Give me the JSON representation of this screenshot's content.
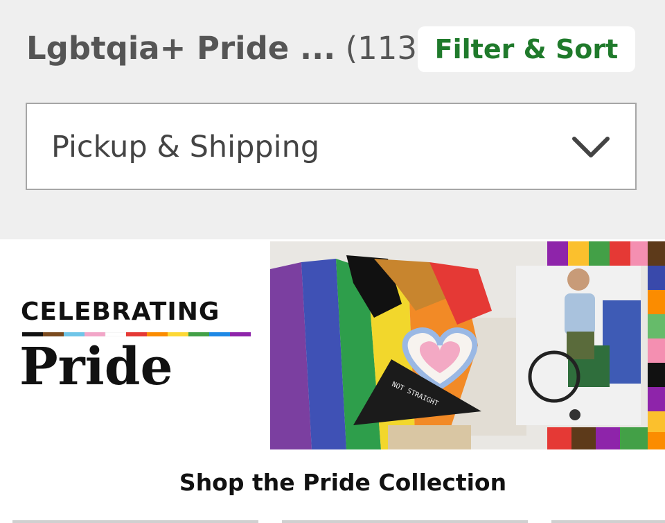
{
  "header": {
    "title": "Lgbtqia+ Pride ...",
    "count": "(113)",
    "filter_button": "Filter & Sort"
  },
  "fulfillment_select": {
    "label": "Pickup & Shipping",
    "icon": "chevron-down-icon"
  },
  "banner": {
    "eyebrow": "CELEBRATING",
    "headline": "Pride",
    "pillow_text": "NOT STRAIGHT"
  },
  "promo": {
    "caption": "Shop the Pride Collection"
  },
  "colors": {
    "accent_green": "#1f7a2b",
    "background": "#efefef"
  }
}
